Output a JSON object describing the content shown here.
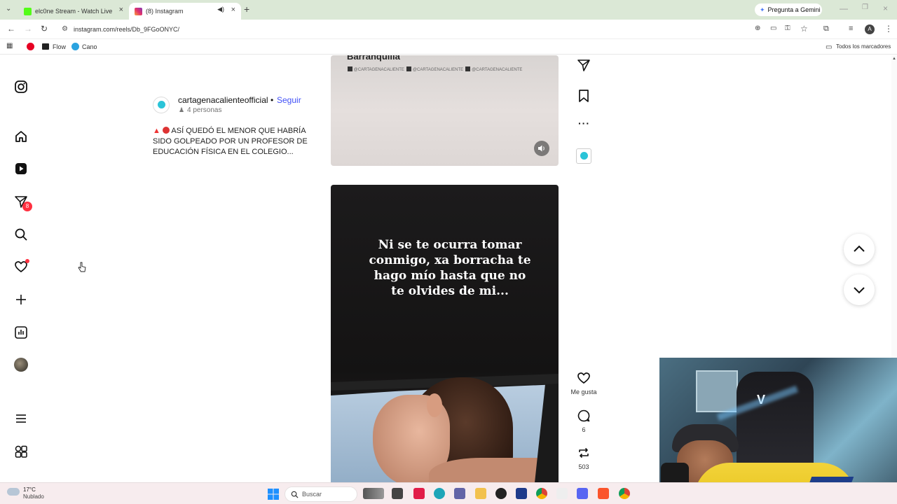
{
  "browser": {
    "tabs": [
      {
        "label": "elc0ne Stream - Watch Live on K",
        "active": false
      },
      {
        "label": "(8) Instagram",
        "active": true
      }
    ],
    "new_tab": "+",
    "gemini_label": "Pregunta a Gemini",
    "url": "instagram.com/reels/Db_9FGoONYC/",
    "bookmarks": [
      "Flow",
      "Cano"
    ],
    "bookmarks_folder": "Todos los marcadores"
  },
  "instagram": {
    "nav_badge_count": "8",
    "post1": {
      "username": "cartagenacalienteofficial",
      "follow": "Seguir",
      "people": "4 personas",
      "caption": "ASÍ QUEDÓ EL MENOR QUE HABRÍA SIDO GOLPEADO POR UN PROFESOR DE EDUCACIÓN FÍSICA EN EL COLEGIO...",
      "video_title": "Barranquilla",
      "watermarks": [
        "@CARTAGENACALIENTE",
        "@CARTAGENACALIENTE",
        "@CARTAGENACALIENTE"
      ]
    },
    "post2": {
      "overlay_text": "Ni se te ocurra tomar conmigo, xa borracha te hago mío hasta que no te olvides de mi...",
      "likes_label": "Me gusta",
      "comments": "6",
      "reposts": "503"
    }
  },
  "taskbar": {
    "weather_temp": "17°C",
    "weather_desc": "Nublado",
    "search_placeholder": "Buscar"
  },
  "colors": {
    "tabbar_bg": "#dbe8d6",
    "instagram_link": "#4150f7",
    "notification_red": "#ff3040",
    "taskbar_bg": "#f7ecee"
  }
}
